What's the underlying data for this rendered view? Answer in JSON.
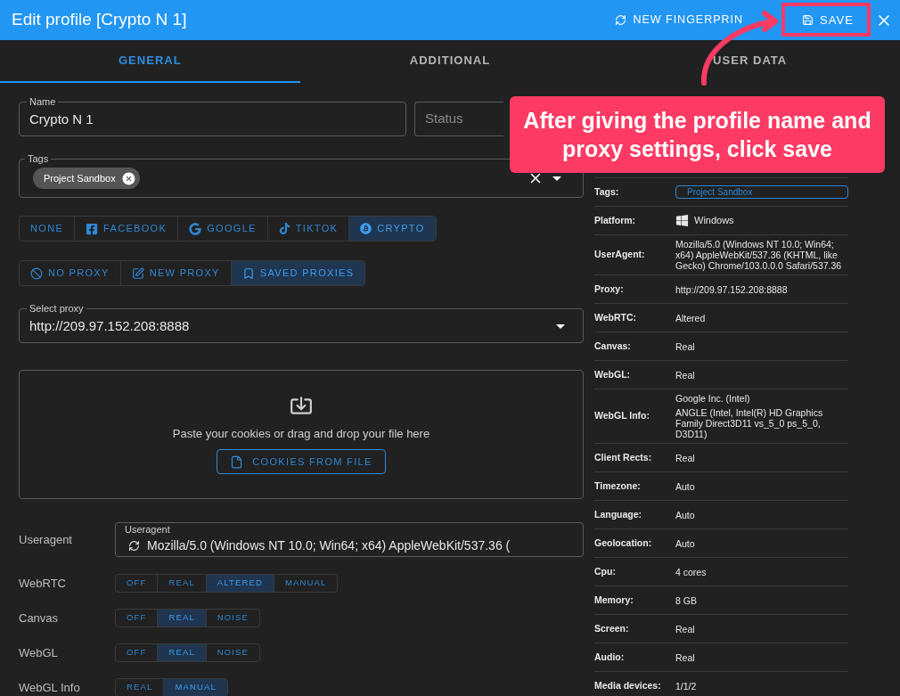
{
  "window": {
    "title": "Edit profile [Crypto N 1]",
    "actions": [
      {
        "kind": "fingerprint",
        "label": "NEW FINGERPRIN"
      },
      {
        "kind": "save",
        "label": "SAVE"
      }
    ]
  },
  "tabs": [
    {
      "label": "GENERAL",
      "selected": true
    },
    {
      "label": "ADDITIONAL",
      "selected": false
    },
    {
      "label": "USER DATA",
      "selected": false
    }
  ],
  "name_field": {
    "label": "Name",
    "value": "Crypto N 1"
  },
  "status_field": {
    "placeholder": "Status"
  },
  "tags_field": {
    "label": "Tags",
    "chips": [
      "Project Sandbox"
    ]
  },
  "platforms": [
    {
      "kind": "none",
      "label": "NONE",
      "selected": false
    },
    {
      "kind": "facebook",
      "label": "FACEBOOK",
      "selected": false
    },
    {
      "kind": "google",
      "label": "GOOGLE",
      "selected": false
    },
    {
      "kind": "tiktok",
      "label": "TIKTOK",
      "selected": false
    },
    {
      "kind": "crypto",
      "label": "CRYPTO",
      "selected": true
    }
  ],
  "proxy_modes": [
    {
      "kind": "none",
      "label": "NO PROXY",
      "selected": false
    },
    {
      "kind": "new",
      "label": "NEW PROXY",
      "selected": false
    },
    {
      "kind": "saved",
      "label": "SAVED PROXIES",
      "selected": true
    }
  ],
  "select_proxy": {
    "label": "Select proxy",
    "value": "http://209.97.152.208:8888"
  },
  "cookies": {
    "text": "Paste your cookies or drag and drop your file here",
    "button": "COOKIES FROM FILE"
  },
  "useragent": {
    "label": "Useragent",
    "field_label": "Useragent",
    "value": "Mozilla/5.0 (Windows NT 10.0; Win64; x64) AppleWebKit/537.36 ("
  },
  "settings": [
    {
      "label": "WebRTC",
      "options": [
        {
          "label": "OFF",
          "selected": false
        },
        {
          "label": "REAL",
          "selected": false
        },
        {
          "label": "ALTERED",
          "selected": true
        },
        {
          "label": "MANUAL",
          "selected": false
        }
      ]
    },
    {
      "label": "Canvas",
      "options": [
        {
          "label": "OFF",
          "selected": false
        },
        {
          "label": "REAL",
          "selected": true
        },
        {
          "label": "NOISE",
          "selected": false
        }
      ]
    },
    {
      "label": "WebGL",
      "options": [
        {
          "label": "OFF",
          "selected": false
        },
        {
          "label": "REAL",
          "selected": true
        },
        {
          "label": "NOISE",
          "selected": false
        }
      ]
    },
    {
      "label": "WebGL Info",
      "options": [
        {
          "label": "REAL",
          "selected": false
        },
        {
          "label": "MANUAL",
          "selected": true
        }
      ]
    }
  ],
  "summary": [
    {
      "kind": "tag",
      "label": "Tags:",
      "value": [
        "Project Sandbox"
      ]
    },
    {
      "kind": "platform",
      "label": "Platform:",
      "value": [
        "Windows"
      ]
    },
    {
      "kind": "text",
      "label": "UserAgent:",
      "value": [
        "Mozilla/5.0 (Windows NT 10.0; Win64; x64) AppleWebKit/537.36 (KHTML, like Gecko) Chrome/103.0.0.0 Safari/537.36"
      ]
    },
    {
      "kind": "text",
      "label": "Proxy:",
      "value": [
        "http://209.97.152.208:8888"
      ]
    },
    {
      "kind": "text",
      "label": "WebRTC:",
      "value": [
        "Altered"
      ]
    },
    {
      "kind": "text",
      "label": "Canvas:",
      "value": [
        "Real"
      ]
    },
    {
      "kind": "text",
      "label": "WebGL:",
      "value": [
        "Real"
      ]
    },
    {
      "kind": "text",
      "label": "WebGL Info:",
      "value": [
        "Google Inc. (Intel)",
        "ANGLE (Intel, Intel(R) HD Graphics Family Direct3D11 vs_5_0 ps_5_0, D3D11)"
      ]
    },
    {
      "kind": "text",
      "label": "Client Rects:",
      "value": [
        "Real"
      ]
    },
    {
      "kind": "text",
      "label": "Timezone:",
      "value": [
        "Auto"
      ]
    },
    {
      "kind": "text",
      "label": "Language:",
      "value": [
        "Auto"
      ]
    },
    {
      "kind": "text",
      "label": "Geolocation:",
      "value": [
        "Auto"
      ]
    },
    {
      "kind": "text",
      "label": "Cpu:",
      "value": [
        "4 cores"
      ]
    },
    {
      "kind": "text",
      "label": "Memory:",
      "value": [
        "8 GB"
      ]
    },
    {
      "kind": "text",
      "label": "Screen:",
      "value": [
        "Real"
      ]
    },
    {
      "kind": "text",
      "label": "Audio:",
      "value": [
        "Real"
      ]
    },
    {
      "kind": "text",
      "label": "Media devices:",
      "value": [
        "1/1/2"
      ]
    }
  ],
  "callout": {
    "text": "After giving the profile name and proxy settings, click save"
  }
}
